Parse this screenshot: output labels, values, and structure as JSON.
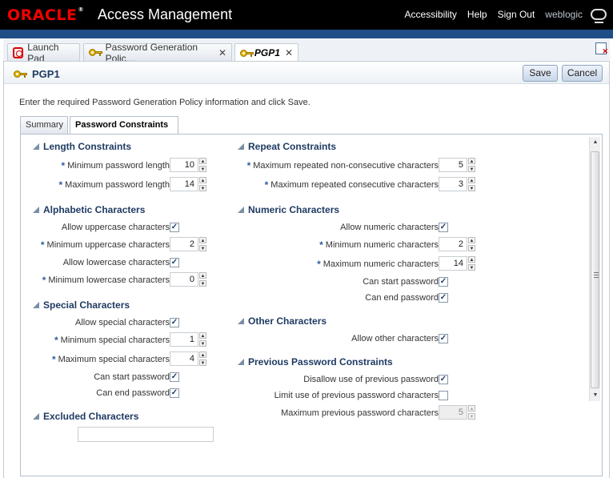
{
  "header": {
    "logo": "ORACLE",
    "logo_reg": "®",
    "app_title": "Access Management",
    "links": {
      "accessibility": "Accessibility",
      "help": "Help",
      "sign_out": "Sign Out",
      "user": "weblogic"
    }
  },
  "tabs": [
    {
      "label": "Launch Pad",
      "icon": "launch-pad-icon"
    },
    {
      "label": "Password Generation Polic…",
      "icon": "key-icon",
      "close": "✕"
    },
    {
      "label": "PGP1",
      "icon": "key-icon",
      "close": "✕"
    }
  ],
  "page": {
    "title": "PGP1",
    "save": "Save",
    "cancel": "Cancel",
    "instructions": "Enter the required Password Generation Policy information and click Save."
  },
  "subtabs": {
    "summary": "Summary",
    "constraints": "Password Constraints"
  },
  "length": {
    "title": "Length Constraints",
    "min_label": "Minimum password length",
    "min_value": "10",
    "max_label": "Maximum password length",
    "max_value": "14"
  },
  "alpha": {
    "title": "Alphabetic Characters",
    "allow_upper": "Allow uppercase characters",
    "allow_upper_checked": true,
    "min_upper_label": "Minimum uppercase characters",
    "min_upper_value": "2",
    "allow_lower": "Allow lowercase characters",
    "allow_lower_checked": true,
    "min_lower_label": "Minimum lowercase characters",
    "min_lower_value": "0"
  },
  "special": {
    "title": "Special Characters",
    "allow": "Allow special characters",
    "allow_checked": true,
    "min_label": "Minimum special characters",
    "min_value": "1",
    "max_label": "Maximum special characters",
    "max_value": "4",
    "can_start": "Can start password",
    "can_start_checked": true,
    "can_end": "Can end password",
    "can_end_checked": true
  },
  "excluded": {
    "title": "Excluded Characters",
    "value": ""
  },
  "repeat": {
    "title": "Repeat Constraints",
    "nonconsec_label": "Maximum repeated non-consecutive characters",
    "nonconsec_value": "5",
    "consec_label": "Maximum repeated consecutive characters",
    "consec_value": "3"
  },
  "numeric": {
    "title": "Numeric Characters",
    "allow": "Allow numeric characters",
    "allow_checked": true,
    "min_label": "Minimum numeric characters",
    "min_value": "2",
    "max_label": "Maximum numeric characters",
    "max_value": "14",
    "can_start": "Can start password",
    "can_start_checked": true,
    "can_end": "Can end password",
    "can_end_checked": true
  },
  "other": {
    "title": "Other Characters",
    "allow": "Allow other characters",
    "allow_checked": true
  },
  "previous": {
    "title": "Previous Password Constraints",
    "disallow": "Disallow use of previous password",
    "disallow_checked": true,
    "limit": "Limit use of previous password characters",
    "limit_checked": false,
    "max_label": "Maximum previous password characters",
    "max_value": "5"
  },
  "required_marker": "*",
  "check_glyph": "✓"
}
